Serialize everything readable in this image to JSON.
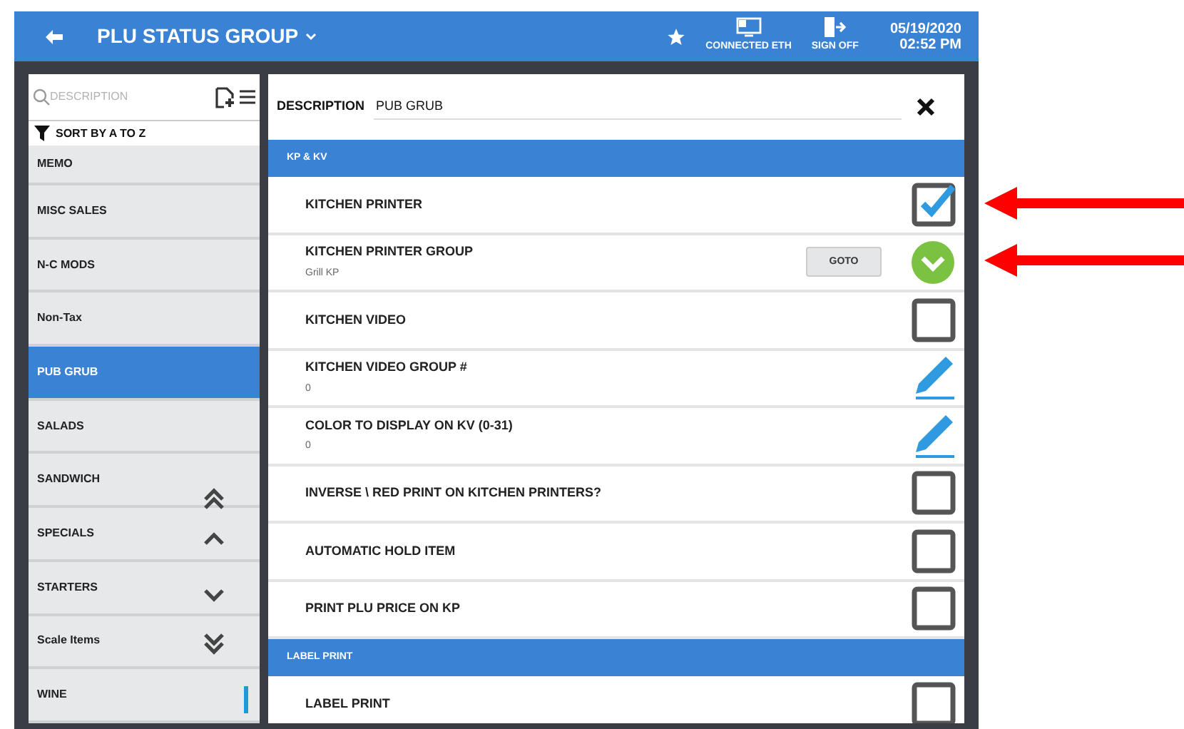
{
  "header": {
    "title": "PLU STATUS GROUP",
    "status": [
      {
        "kind": "network",
        "label": "CONNECTED ETH"
      },
      {
        "kind": "signoff",
        "label": "SIGN OFF"
      }
    ],
    "date": "05/19/2020",
    "time": "02:52 PM"
  },
  "sidebar": {
    "search_placeholder": "DESCRIPTION",
    "sort_label": "SORT BY A TO Z",
    "items": [
      {
        "label": "MEMO",
        "selected": false
      },
      {
        "label": "MISC SALES",
        "selected": false
      },
      {
        "label": "N-C MODS",
        "selected": false
      },
      {
        "label": "Non-Tax",
        "selected": false
      },
      {
        "label": "PUB GRUB",
        "selected": true
      },
      {
        "label": "SALADS",
        "selected": false
      },
      {
        "label": "SANDWICH",
        "selected": false
      },
      {
        "label": "SPECIALS",
        "selected": false
      },
      {
        "label": "STARTERS",
        "selected": false
      },
      {
        "label": "Scale Items",
        "selected": false
      },
      {
        "label": "WINE",
        "selected": false
      }
    ]
  },
  "form": {
    "description_label": "DESCRIPTION",
    "description_value": "PUB GRUB",
    "sections": [
      {
        "title": "KP & KV",
        "rows": [
          {
            "kind": "checkbox",
            "label": "KITCHEN PRINTER",
            "checked": true
          },
          {
            "kind": "select",
            "label": "KITCHEN PRINTER GROUP",
            "value": "Grill KP",
            "button": "GOTO"
          },
          {
            "kind": "checkbox",
            "label": "KITCHEN VIDEO",
            "checked": false
          },
          {
            "kind": "edit",
            "label": "KITCHEN VIDEO GROUP #",
            "value": "0"
          },
          {
            "kind": "edit",
            "label": "COLOR TO DISPLAY ON KV (0-31)",
            "value": "0"
          },
          {
            "kind": "checkbox",
            "label": "INVERSE \\ RED PRINT ON KITCHEN PRINTERS?",
            "checked": false
          },
          {
            "kind": "checkbox",
            "label": "AUTOMATIC HOLD ITEM",
            "checked": false
          },
          {
            "kind": "checkbox",
            "label": "PRINT PLU PRICE ON KP",
            "checked": false
          }
        ]
      },
      {
        "title": "LABEL PRINT",
        "rows": [
          {
            "kind": "checkbox",
            "label": "LABEL PRINT",
            "checked": false
          }
        ]
      }
    ]
  }
}
